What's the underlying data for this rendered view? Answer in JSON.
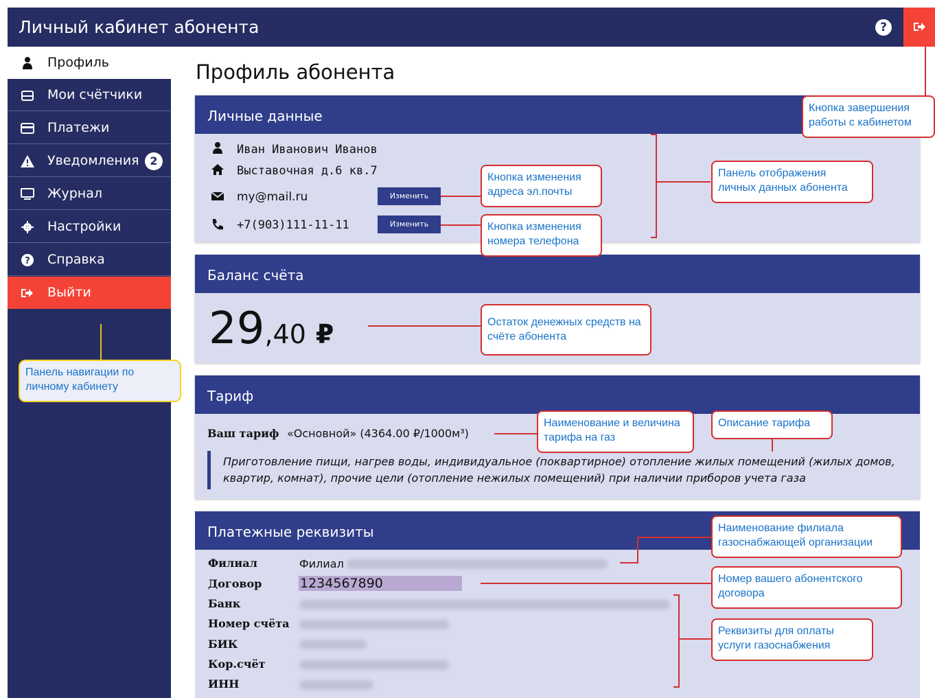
{
  "header": {
    "title": "Личный кабинет абонента",
    "help_icon": "question-circle-icon",
    "logout_icon": "sign-out-icon"
  },
  "sidebar": {
    "items": [
      {
        "label": "Профиль",
        "icon": "user-icon",
        "active": true
      },
      {
        "label": "Мои счётчики",
        "icon": "meter-icon"
      },
      {
        "label": "Платежи",
        "icon": "credit-card-icon"
      },
      {
        "label": "Уведомления",
        "icon": "warning-icon",
        "badge": "2"
      },
      {
        "label": "Журнал",
        "icon": "monitor-icon"
      },
      {
        "label": "Настройки",
        "icon": "gear-icon"
      },
      {
        "label": "Справка",
        "icon": "question-circle-icon"
      },
      {
        "label": "Выйти",
        "icon": "sign-out-icon",
        "color": "#f44336"
      }
    ]
  },
  "main": {
    "page_title": "Профиль абонента",
    "personal": {
      "heading": "Личные данные",
      "name": "Иван Иванович Иванов",
      "address": "Выставочная д.6 кв.7",
      "email": "my@mail.ru",
      "phone": "+7(903)111-11-11",
      "change_label": "Изменить"
    },
    "balance": {
      "heading": "Баланс счёта",
      "integer": "29",
      "fraction": ",40",
      "currency": "₽"
    },
    "tariff": {
      "heading": "Тариф",
      "label": "Ваш тариф",
      "value": "«Основной» (4364.00 ₽/1000м³)",
      "description": "Приготовление пищи, нагрев воды, индивидуальное (поквартирное) отопление жилых помещений (жилых домов, квартир, комнат), прочие цели (отопление нежилых помещений) при наличии приборов учета газа"
    },
    "requisites": {
      "heading": "Платежные реквизиты",
      "branch_label": "Филиал",
      "branch_value": "Филиал",
      "contract_label": "Договор",
      "contract_value": "1234567890",
      "bank_label": "Банк",
      "account_label": "Номер счёта",
      "bik_label": "БИК",
      "corr_label": "Кор.счёт",
      "inn_label": "ИНН"
    }
  },
  "annotations": {
    "logout": "Кнопка завершения работы с кабинетом",
    "email_change": "Кнопка изменения адреса эл.почты",
    "personal_panel": "Панель отображения личных данных абонента",
    "phone_change": "Кнопка изменения номера телефона",
    "balance": "Остаток денежных средств на счёте абонента",
    "navigation": "Панель навигации по личному кабинету",
    "tariff_name": "Наименование и величина тарифа на газ",
    "tariff_desc": "Описание тарифа",
    "branch": "Наименование филиала газоснабжающей организации",
    "contract": "Номер вашего абонентского договора",
    "payment": "Реквизиты для оплаты услуги газоснабжения"
  },
  "colors": {
    "navy": "#252d62",
    "card_head": "#2f3d8a",
    "card_bg": "#d9dbef",
    "accent_red": "#f44336",
    "callout_text": "#1a73c9"
  }
}
